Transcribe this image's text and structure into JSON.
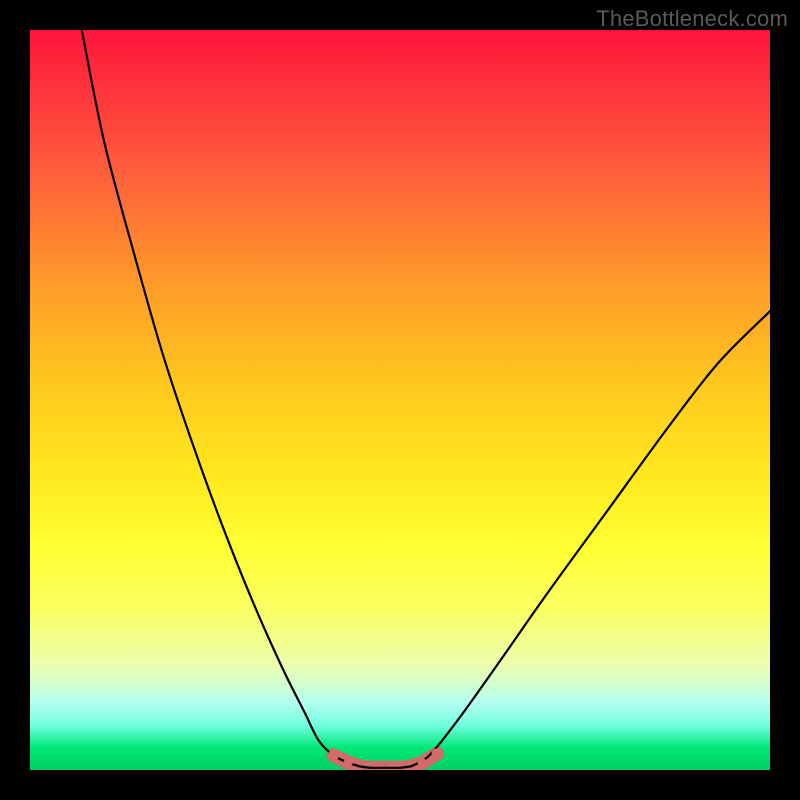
{
  "watermark": "TheBottleneck.com",
  "chart_data": {
    "type": "line",
    "title": "",
    "xlabel": "",
    "ylabel": "",
    "xlim": [
      0,
      100
    ],
    "ylim": [
      0,
      100
    ],
    "series": [
      {
        "name": "left-curve",
        "x": [
          7,
          10,
          14,
          18,
          22,
          26,
          30,
          34,
          37,
          39,
          41,
          43,
          44.5
        ],
        "y": [
          100,
          85,
          70,
          56,
          44,
          33,
          23,
          14,
          8,
          4,
          2,
          1,
          0.5
        ]
      },
      {
        "name": "valley-floor",
        "x": [
          44.5,
          46,
          48,
          50,
          51.5
        ],
        "y": [
          0.5,
          0.3,
          0.3,
          0.3,
          0.5
        ]
      },
      {
        "name": "right-curve",
        "x": [
          51.5,
          54,
          58,
          63,
          70,
          78,
          86,
          93,
          100
        ],
        "y": [
          0.5,
          2,
          7,
          14,
          24,
          35,
          46,
          55,
          62
        ]
      }
    ],
    "valley_marker": {
      "color": "#d26a6a",
      "x": [
        41,
        43,
        44.5,
        46,
        48,
        50,
        51.5,
        53,
        55
      ],
      "y": [
        2.0,
        1.0,
        0.5,
        0.3,
        0.3,
        0.3,
        0.5,
        1.0,
        2.2
      ]
    }
  }
}
